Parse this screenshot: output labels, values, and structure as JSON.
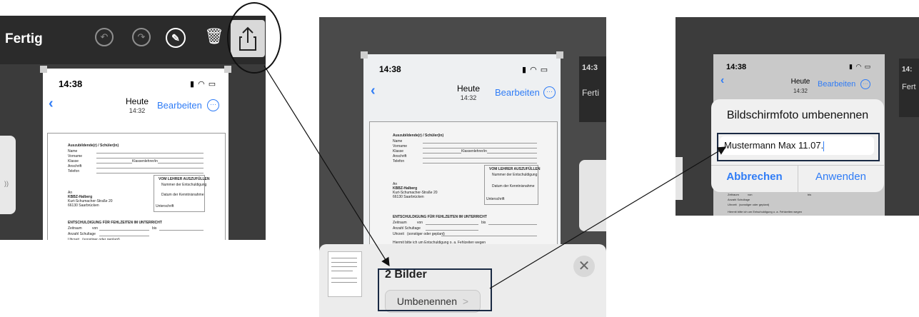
{
  "panel1": {
    "done_label": "Fertig",
    "undo_icon": "undo-icon",
    "redo_icon": "redo-icon",
    "markup_icon": "markup-pen-icon",
    "trash_icon": "trash-icon",
    "share_icon": "share-icon",
    "status_time": "14:38",
    "title": "Heute",
    "subtitle": "14:32",
    "edit_label": "Bearbeiten"
  },
  "document": {
    "section1": "Auszubildende(r) / Schüler(in)",
    "fields": [
      "Name",
      "Vorname",
      "Klasse",
      "Anschrift",
      "Telefon"
    ],
    "class_teacher": "Klassenlehrer/in",
    "teacher_box_title": "VOM LEHRER AUSZUFÜLLEN",
    "teacher_box_line1": "Nummer der Entschuldigung",
    "teacher_box_line2": "Datum der Kenntnisnahme",
    "teacher_box_line3": "Unterschrift",
    "to": "An",
    "school": "KBBZ-Halberg",
    "street": "Kurt-Schumacher-Straße 20",
    "city": "66130 Saarbrücken",
    "heading": "ENTSCHULDIGUNG FÜR FEHLZEITEN IM UNTERRICHT",
    "period_label": "Zeitraum",
    "from_label": "von",
    "to_label": "bis",
    "hours_label": "Anzahl Schultage",
    "time_label": "Uhrzeit",
    "time_note": "(sonstiger oder geplant)",
    "reason_text": "Hiermit bitte ich um Entschuldigung o. a. Fehlzeiten wegen"
  },
  "panel2": {
    "count_label": "2 Bilder",
    "rename_label": "Umbenennen",
    "rename_chevron": ">",
    "close_icon": "close-icon",
    "side_label": "Ferti",
    "side_time": "14:3"
  },
  "panel3": {
    "dialog_title": "Bildschirmfoto umbenennen",
    "input_value": "Mustermann Max 11.07.",
    "cancel_label": "Abbrechen",
    "apply_label": "Anwenden",
    "side_label": "Fert",
    "side_time": "14:"
  },
  "colors": {
    "accent_blue": "#2f7cf6",
    "dark_toolbar": "#2b2b2b",
    "highlight_frame": "#1a2a44"
  }
}
